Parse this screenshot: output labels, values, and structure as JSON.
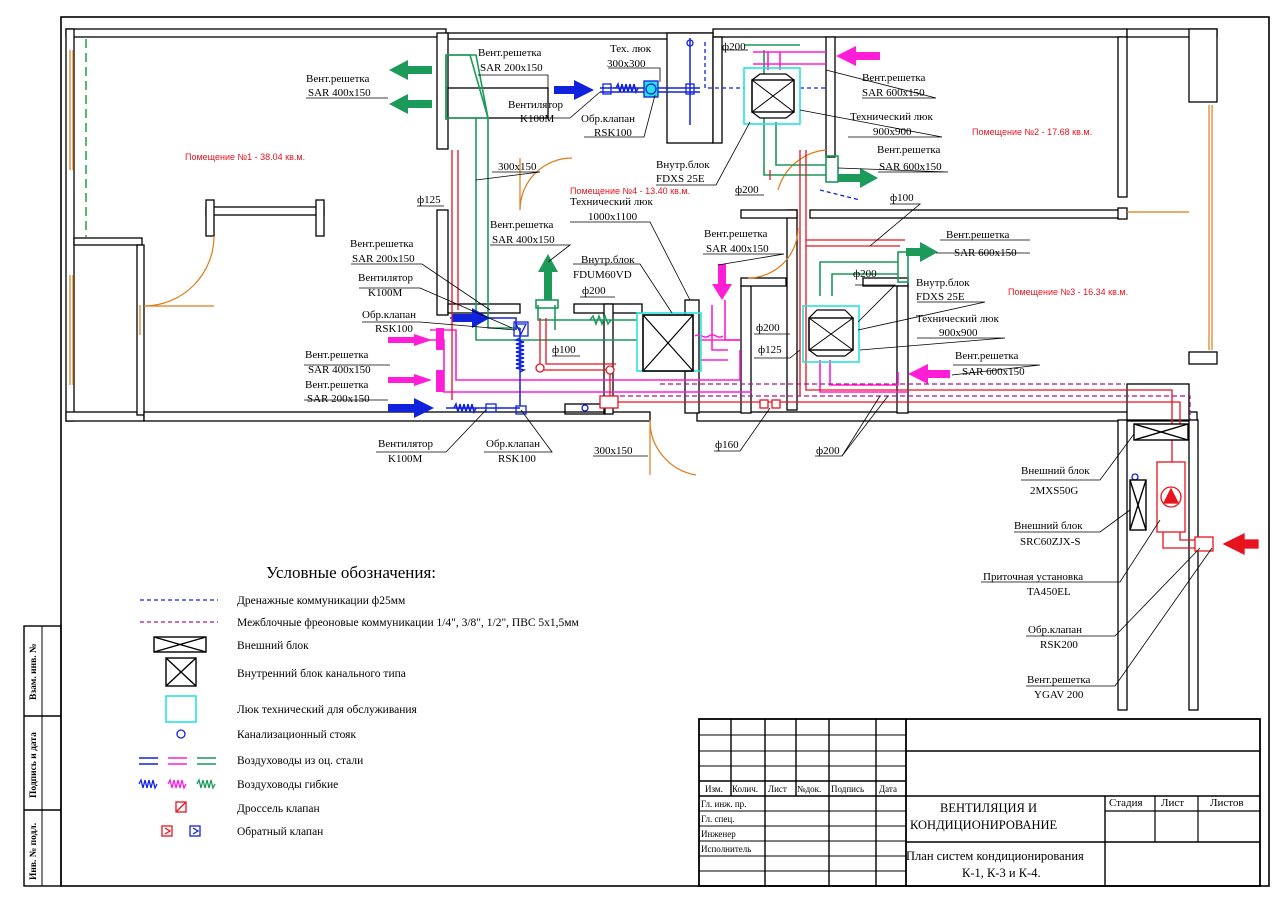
{
  "rooms": {
    "r1": "Помещение №1 - 38.04 кв.м.",
    "r2": "Помещение №2 - 17.68 кв.м.",
    "r3": "Помещение №3 - 16.34 кв.м.",
    "r4": "Помещение №4 - 13.40 кв.м."
  },
  "labels": {
    "grille_left_top_1": "Вент.решетка",
    "grille_left_top_2": "SAR  400х150",
    "grille_200_1": "Вент.решетка",
    "grille_200_2": "SAR 200х150",
    "tech_hatch_300_1": "Тех. люк",
    "tech_hatch_300_2": "300х300",
    "fan_top_1": "Вентилятор",
    "fan_top_2": "K100M",
    "check_valve_top_1": "Обр.клапан",
    "check_valve_top_2": "RSK100",
    "phi200_top": "ф200",
    "grille_600_top_1": "Вент.решетка",
    "grille_600_top_2": "SAR 600х150",
    "tech_hatch_900_top_1": "Технический люк",
    "tech_hatch_900_top_2": "900х900",
    "duct_300x150_top": "300х150",
    "indoor_fdxs_top_1": "Внутр.блок",
    "indoor_fdxs_top_2": "FDXS 25E",
    "grille_600_mid_1": "Вент.решетка",
    "grille_600_mid_2": "SAR 600х150",
    "phi200_b": "ф200",
    "phi100_a": "ф100",
    "phi125_a": "ф125",
    "tech_hatch_1000_1": "Технический люк",
    "tech_hatch_1000_2": "1000х1100",
    "grille_400_mid_1": "Вент.решетка",
    "grille_400_mid_2": "SAR  400х150",
    "grille_200_mid_1": "Вент.решетка",
    "grille_200_mid_2": "SAR 200х150",
    "fan_mid_1": "Вентилятор",
    "fan_mid_2": "K100M",
    "check_valve_mid_1": "Обр.клапан",
    "check_valve_mid_2": "RSK100",
    "indoor_fdum_1": "Внутр.блок",
    "indoor_fdum_2": "FDUM60VD",
    "phi200_c": "ф200",
    "grille_400_right_1": "Вент.решетка",
    "grille_400_right_2": "SAR  400х150",
    "grille_600_r3_1": "Вент.решетка",
    "grille_600_r3_2": "SAR 600х150",
    "phi200_d": "ф200",
    "indoor_fdxs_r3_1": "Внутр.блок",
    "indoor_fdxs_r3_2": "FDXS 25E",
    "tech_hatch_900_r3_1": "Технический люк",
    "tech_hatch_900_r3_2": "900х900",
    "phi200_e": "ф200",
    "phi125_b": "ф125",
    "grille_600_r3b_1": "Вент.решетка",
    "grille_600_r3b_2": "SAR 600х150",
    "phi100_b": "ф100",
    "grille_400_low_1": "Вент.решетка",
    "grille_400_low_2": "SAR  400х150",
    "grille_200_low_1": "Вент.решетка",
    "grille_200_low_2": "SAR 200х150",
    "fan_low_1": "Вентилятор",
    "fan_low_2": "K100M",
    "check_valve_low_1": "Обр.клапан",
    "check_valve_low_2": "RSK100",
    "duct_300x150_low": "300х150",
    "phi160": "ф160",
    "phi200_f": "ф200",
    "outdoor_2mxs_1": "Внешний блок",
    "outdoor_2mxs_2": "2MXS50G",
    "outdoor_src_1": "Внешний блок",
    "outdoor_src_2": "SRC60ZJX-S",
    "supply_unit_1": "Приточная установка",
    "supply_unit_2": "TA450EL",
    "check_valve_rsk200_1": "Обр.клапан",
    "check_valve_rsk200_2": "RSK200",
    "grille_ygav_1": "Вент.решетка",
    "grille_ygav_2": "YGAV 200"
  },
  "legend": {
    "title": "Условные обозначения:",
    "items": [
      "Дренажные коммуникации  ф25мм",
      "Межблочные фреоновые коммуникации  1/4\", 3/8\", 1/2\", ПВС 5х1,5мм",
      "Внешний блок",
      "Внутренний блок канального типа",
      "Люк технический для обслуживания",
      "Канализационный стояк",
      "Воздуховоды из оц. стали",
      "Воздуховоды гибкие",
      "Дроссель клапан",
      "Обратный клапан"
    ]
  },
  "title_block": {
    "cols": [
      "Изм.",
      "Колич.",
      "Лист",
      "№док.",
      "Подпись",
      "Дата"
    ],
    "rows": [
      "Гл. инж. пр.",
      "Гл. спец.",
      "Инженер",
      "Исполнитель"
    ],
    "project_line1": "ВЕНТИЛЯЦИЯ      И",
    "project_line2": "КОНДИЦИОНИРОВАНИЕ",
    "stage": "Стадия",
    "sheet": "Лист",
    "sheets": "Листов",
    "drawing_line1": "План систем кондиционирования",
    "drawing_line2": "К-1, К-3 и К-4."
  },
  "side_stamp": [
    "Взам. инв. №",
    "Подпись и дата",
    "Инв. № подл."
  ],
  "colors": {
    "wall": "#000000",
    "supply_green": "#1c9a5a",
    "pink": "#ff1dd6",
    "blue": "#1122dd",
    "red": "#e8131f",
    "cyan": "#27e3e3",
    "door": "#e07a1a"
  }
}
